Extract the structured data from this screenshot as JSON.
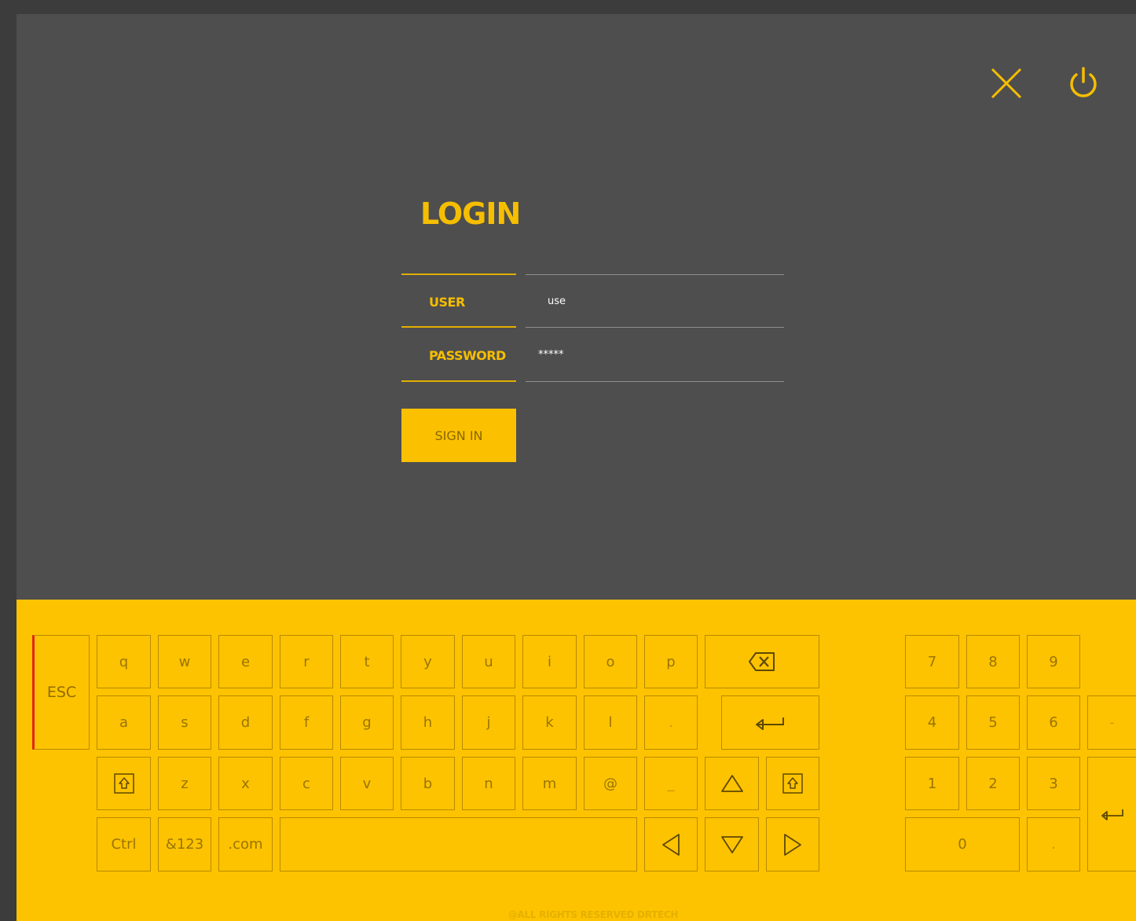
{
  "title": "LOGIN",
  "form": {
    "user_label": "USER",
    "user_value": "use",
    "password_label": "PASSWORD",
    "password_value": "*****",
    "signin_label": "SIGN IN"
  },
  "keyboard": {
    "esc": "ESC",
    "row1": [
      "q",
      "w",
      "e",
      "r",
      "t",
      "y",
      "u",
      "i",
      "o",
      "p"
    ],
    "row2": [
      "a",
      "s",
      "d",
      "f",
      "g",
      "h",
      "j",
      "k",
      "l",
      "."
    ],
    "row3": [
      "z",
      "x",
      "c",
      "v",
      "b",
      "n",
      "m",
      "@",
      "_"
    ],
    "row4": [
      "Ctrl",
      "&123",
      ".com"
    ],
    "numpad": {
      "row1": [
        "7",
        "8",
        "9"
      ],
      "row2": [
        "4",
        "5",
        "6",
        "-"
      ],
      "row3": [
        "1",
        "2",
        "3"
      ],
      "zero": "0",
      "dot": "."
    }
  },
  "footer": "@ALL RIGHTS RESERVED DRTECH",
  "colors": {
    "accent": "#fdc300",
    "background": "#4e4e4e",
    "frame": "#3c3c3c",
    "esc_marker": "#e0251b"
  },
  "icons": [
    "close-icon",
    "power-icon",
    "backspace-icon",
    "enter-icon",
    "shift-icon",
    "arrow-up-icon",
    "arrow-down-icon",
    "arrow-left-icon",
    "arrow-right-icon"
  ]
}
